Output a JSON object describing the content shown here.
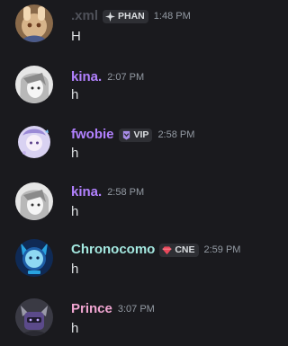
{
  "colors": {
    "background": "#1a1a1e",
    "default_name": "#4e5058",
    "kina": "#b281ff",
    "fwobie": "#b281ff",
    "chronocomo": "#a4e8e0",
    "prince": "#f0a5d1",
    "timestamp": "#949ba4",
    "message_text": "#dbdee1",
    "tag_bg": "#2e2f34"
  },
  "messages": [
    {
      "username": ".xml",
      "tag": {
        "icon": "sparkle-icon",
        "label": "PHAN"
      },
      "time": "1:48 PM",
      "text": "H"
    },
    {
      "username": "kina.",
      "tag": null,
      "time": "2:07 PM",
      "text": "h"
    },
    {
      "username": "fwobie",
      "tag": {
        "icon": "vip-badge-icon",
        "label": "VIP"
      },
      "time": "2:58 PM",
      "text": "h"
    },
    {
      "username": "kina.",
      "tag": null,
      "time": "2:58 PM",
      "text": "h"
    },
    {
      "username": "Chronocomo",
      "tag": {
        "icon": "gem-icon",
        "label": "CNE"
      },
      "time": "2:59 PM",
      "text": "h"
    },
    {
      "username": "Prince",
      "tag": null,
      "time": "3:07 PM",
      "text": "h"
    }
  ]
}
